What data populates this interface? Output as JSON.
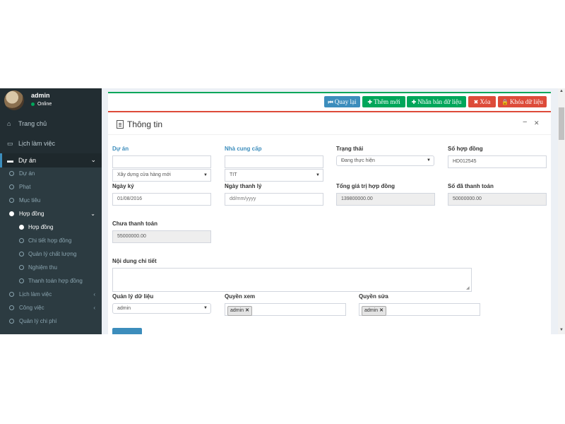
{
  "user": {
    "name": "admin",
    "status": "Online"
  },
  "sidebar": {
    "top_items": [
      {
        "label": "Trang chủ",
        "icon": "home-icon"
      },
      {
        "label": "Lịch làm việc",
        "icon": "calendar-icon"
      },
      {
        "label": "Dự án",
        "icon": "briefcase-icon",
        "active": true
      }
    ],
    "sub_items": [
      {
        "label": "Dự án"
      },
      {
        "label": "Phạt"
      },
      {
        "label": "Mục tiêu"
      },
      {
        "label": "Hợp đồng",
        "expanded": true
      },
      {
        "label": "Hợp đồng",
        "active": true
      },
      {
        "label": "Chi tiết hợp đồng"
      },
      {
        "label": "Quản lý chất lượng"
      },
      {
        "label": "Nghiệm thu"
      },
      {
        "label": "Thanh toán hợp đồng"
      },
      {
        "label": "Lịch làm việc"
      },
      {
        "label": "Công việc"
      },
      {
        "label": "Quản lý chi phí"
      }
    ]
  },
  "toolbar": {
    "back": "Quay lại",
    "add_new": "Thêm mới",
    "duplicate": "Nhân bản dữ liệu",
    "delete": "Xóa",
    "lock": "Khóa dữ liệu"
  },
  "box": {
    "title": "Thông tin"
  },
  "form": {
    "du_an": {
      "label": "Dự án",
      "search_value": "",
      "selected": "Xây dựng cửa hàng mới"
    },
    "nha_cung_cap": {
      "label": "Nhà cung cấp",
      "search_value": "",
      "selected": "TIT"
    },
    "trang_thai": {
      "label": "Trạng thái",
      "selected": "Đang thực hiện"
    },
    "so_hop_dong": {
      "label": "Số hợp đồng",
      "value": "HD012545"
    },
    "ngay_ky": {
      "label": "Ngày ký",
      "value": "01/08/2016"
    },
    "ngay_thanh_ly": {
      "label": "Ngày thanh lý",
      "placeholder": "dd/mm/yyyy"
    },
    "tong_gia_tri": {
      "label": "Tổng giá trị hợp đồng",
      "value": "139800000.00"
    },
    "so_da_thanh_toan": {
      "label": "Số đã thanh toán",
      "value": "50000000.00"
    },
    "chua_thanh_toan": {
      "label": "Chưa thanh toán",
      "value": "55000000.00"
    },
    "noi_dung": {
      "label": "Nội dung chi tiết",
      "value": ""
    },
    "quan_ly_du_lieu": {
      "label": "Quản lý dữ liệu",
      "selected": "admin"
    },
    "quyen_xem": {
      "label": "Quyền xem",
      "tags": [
        "admin"
      ]
    },
    "quyen_sua": {
      "label": "Quyền sửa",
      "tags": [
        "admin"
      ]
    }
  },
  "colors": {
    "sidebar": "#222d32",
    "primary": "#3c8dbc",
    "success": "#00a65a",
    "danger": "#dd4b39"
  }
}
